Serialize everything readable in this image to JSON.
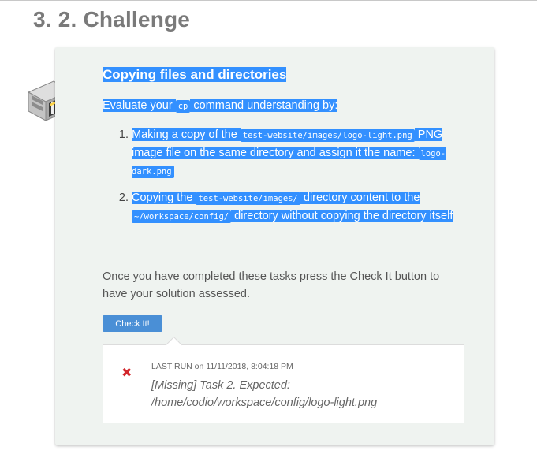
{
  "page": {
    "heading": "3. 2. Challenge"
  },
  "challenge": {
    "title": "Copying files and directories",
    "intro_prefix": "Evaluate your ",
    "intro_code": "cp",
    "intro_suffix": " command understanding by:",
    "tasks": [
      {
        "number": "1.",
        "text_1": "Making a copy of the ",
        "code_1": "test-website/images/logo-light.png",
        "text_2": " PNG image file on the same directory and assign it the name: ",
        "code_2": "logo-dark.png",
        "text_3": ""
      },
      {
        "number": "2.",
        "text_1": "Copying the ",
        "code_1": "test-website/images/",
        "text_2": " directory content to the ",
        "code_2": "~/workspace/config/",
        "text_3": " directory without copying the directory itself"
      }
    ],
    "prompt": "Once you have completed these tasks press the Check It button to have your solution assessed.",
    "check_button": "Check It!",
    "result": {
      "status_icon": "✖",
      "last_run_label": "Last run",
      "last_run_on": " on 11/11/2018, 8:04:18 PM",
      "message": "[Missing] Task 2. Expected: /home/codio/workspace/config/logo-light.png"
    }
  },
  "colors": {
    "selection": "#3390ff",
    "card_background": "#eff3f0",
    "button": "#4a8fd6",
    "error": "#d2262c"
  },
  "icons": {
    "challenge": "building-block-icon",
    "status": "x-mark-icon"
  }
}
